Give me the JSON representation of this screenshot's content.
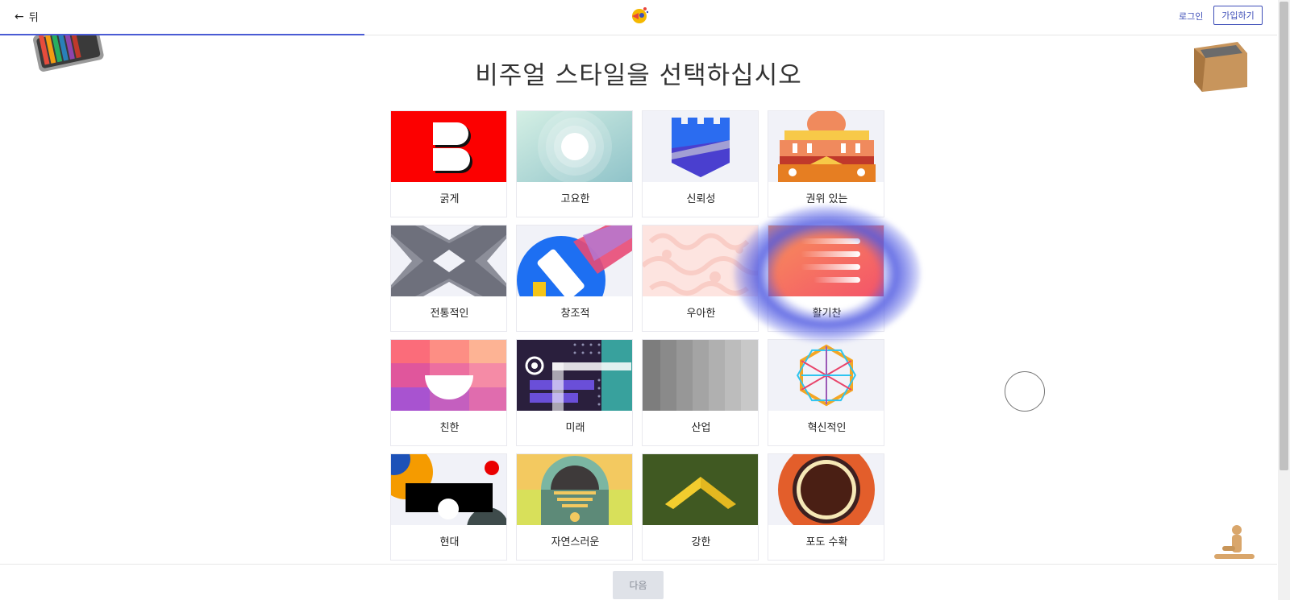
{
  "header": {
    "back_label": "뒤",
    "login_label": "로그인",
    "signup_label": "가입하기"
  },
  "page": {
    "title": "비주얼 스타일을 선택하십시오"
  },
  "styles": [
    {
      "label": "굵게",
      "icon": "bold-style-icon"
    },
    {
      "label": "고요한",
      "icon": "calm-style-icon"
    },
    {
      "label": "신뢰성",
      "icon": "trust-style-icon"
    },
    {
      "label": "권위 있는",
      "icon": "authoritative-style-icon"
    },
    {
      "label": "전통적인",
      "icon": "traditional-style-icon"
    },
    {
      "label": "창조적",
      "icon": "creative-style-icon"
    },
    {
      "label": "우아한",
      "icon": "elegant-style-icon"
    },
    {
      "label": "활기찬",
      "icon": "vibrant-style-icon"
    },
    {
      "label": "친한",
      "icon": "friendly-style-icon"
    },
    {
      "label": "미래",
      "icon": "future-style-icon"
    },
    {
      "label": "산업",
      "icon": "industrial-style-icon"
    },
    {
      "label": "혁신적인",
      "icon": "innovative-style-icon"
    },
    {
      "label": "현대",
      "icon": "modern-style-icon"
    },
    {
      "label": "자연스러운",
      "icon": "natural-style-icon"
    },
    {
      "label": "강한",
      "icon": "strong-style-icon"
    },
    {
      "label": "포도 수확",
      "icon": "vintage-style-icon"
    }
  ],
  "footer": {
    "next_label": "다음"
  },
  "colors": {
    "accent": "#3f4fb8",
    "progress": "#4a5bd4",
    "highlight": "#5a64e6"
  },
  "progress": {
    "fraction": 0.28
  }
}
